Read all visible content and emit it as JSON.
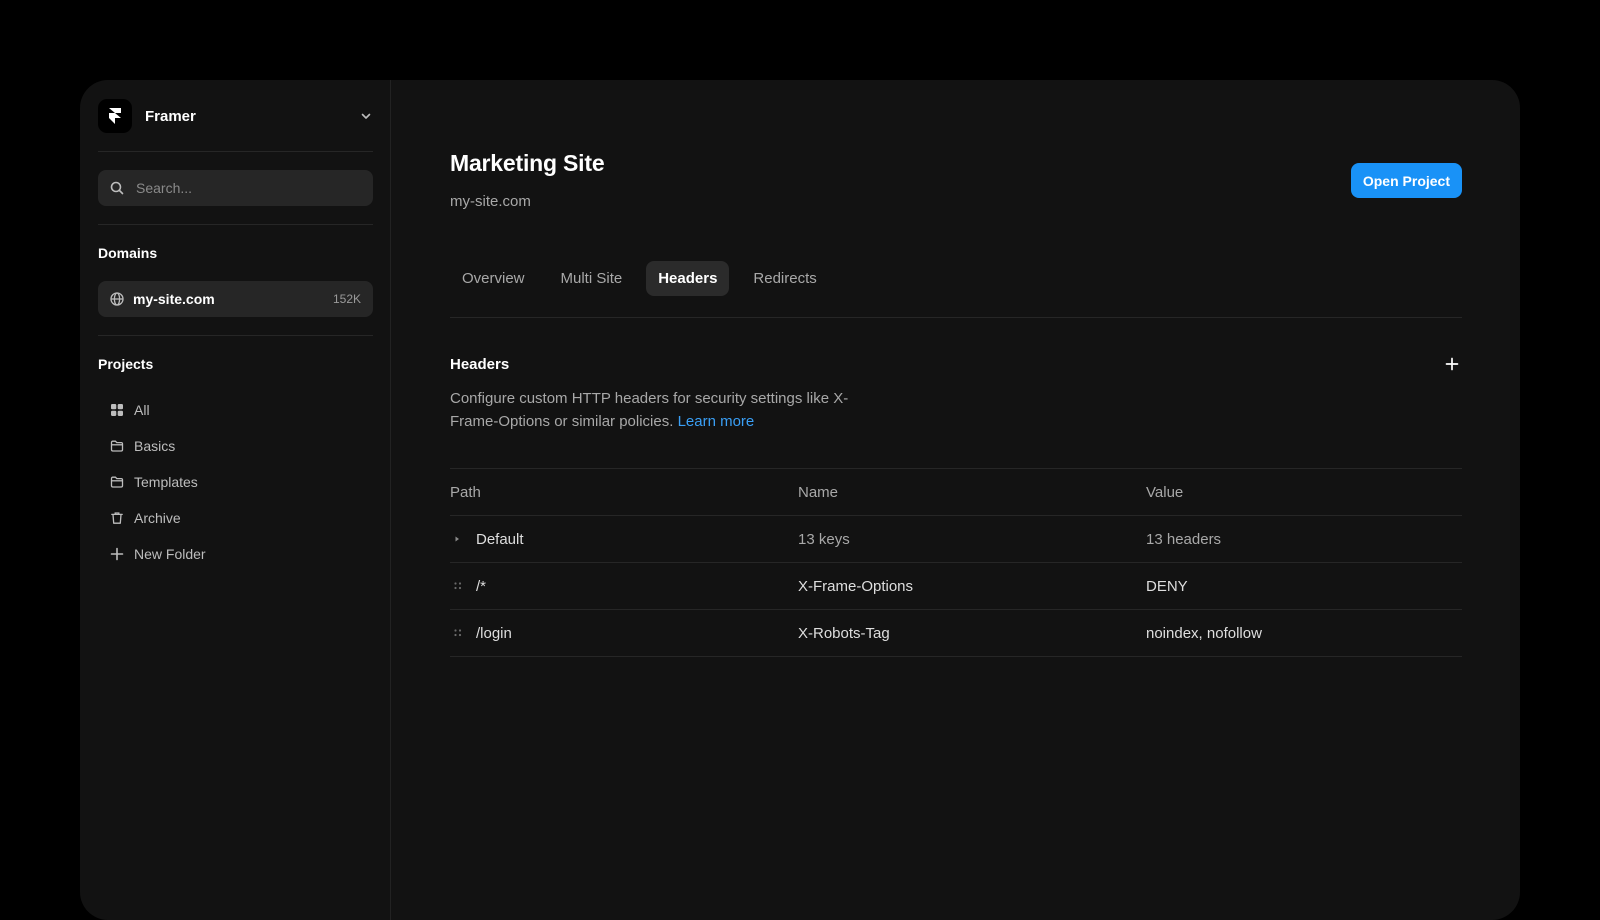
{
  "sidebar": {
    "workspace": {
      "name": "Framer"
    },
    "search": {
      "placeholder": "Search..."
    },
    "domains_title": "Domains",
    "domains": [
      {
        "label": "my-site.com",
        "count": "152K"
      }
    ],
    "projects_title": "Projects",
    "projects": [
      {
        "label": "All",
        "icon": "grid-icon"
      },
      {
        "label": "Basics",
        "icon": "folder-icon"
      },
      {
        "label": "Templates",
        "icon": "folder-icon"
      },
      {
        "label": "Archive",
        "icon": "trash-icon"
      },
      {
        "label": "New Folder",
        "icon": "plus-icon"
      }
    ]
  },
  "main": {
    "title": "Marketing Site",
    "subtitle": "my-site.com",
    "open_project_label": "Open Project",
    "tabs": [
      {
        "label": "Overview",
        "active": false
      },
      {
        "label": "Multi Site",
        "active": false
      },
      {
        "label": "Headers",
        "active": true
      },
      {
        "label": "Redirects",
        "active": false
      }
    ],
    "section": {
      "title": "Headers",
      "description": "Configure custom HTTP headers for security settings like X-Frame-Options or similar policies.",
      "learn_more": "Learn more"
    },
    "table": {
      "columns": [
        "Path",
        "Name",
        "Value"
      ],
      "rows": [
        {
          "path": "Default",
          "name": "13 keys",
          "value": "13 headers",
          "handle": "expand-arrow-icon"
        },
        {
          "path": "/*",
          "name": "X-Frame-Options",
          "value": "DENY",
          "handle": "drag-handle-icon"
        },
        {
          "path": "/login",
          "name": "X-Robots-Tag",
          "value": "noindex, nofollow",
          "handle": "drag-handle-icon"
        }
      ]
    }
  },
  "colors": {
    "accent": "#1992f7",
    "link": "#3a9ff5",
    "background": "#121212",
    "surface": "#262626"
  }
}
